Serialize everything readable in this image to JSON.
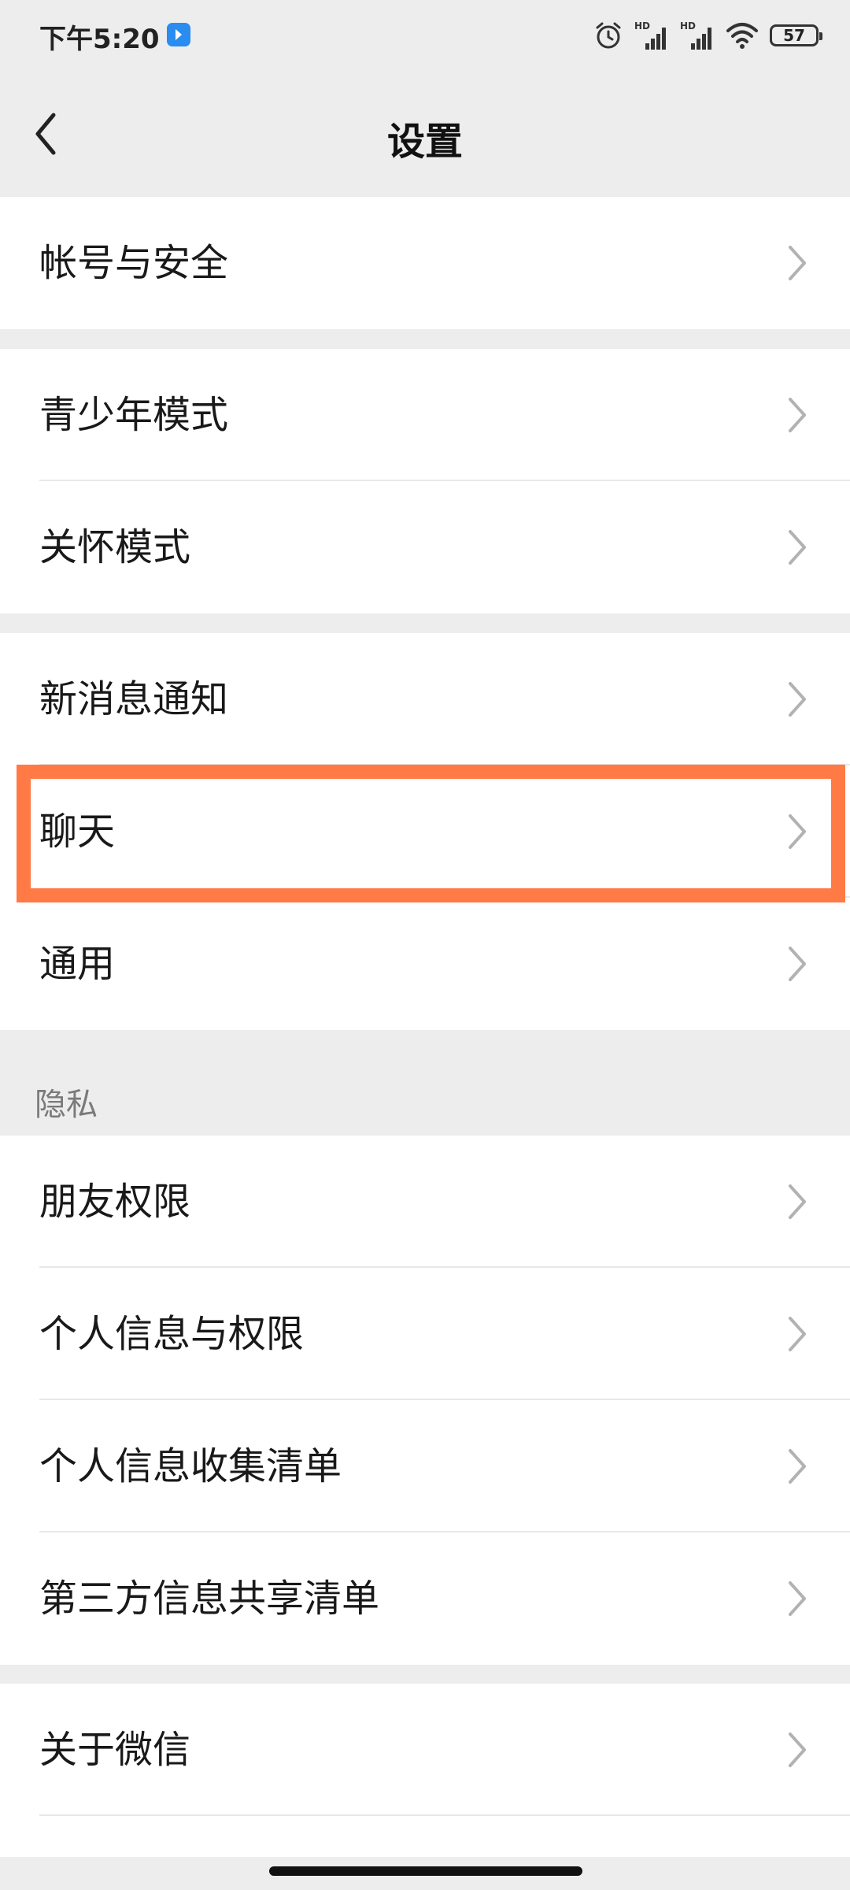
{
  "status_bar": {
    "time": "下午5:20",
    "battery": "57",
    "icons": [
      "app-notification-icon",
      "alarm-icon",
      "hd-signal-icon",
      "hd-signal-icon",
      "wifi-icon",
      "battery-icon"
    ]
  },
  "nav": {
    "title": "设置",
    "back_icon": "chevron-left-icon"
  },
  "groups": [
    {
      "items": [
        "帐号与安全"
      ]
    },
    {
      "items": [
        "青少年模式",
        "关怀模式"
      ]
    },
    {
      "items": [
        "新消息通知",
        "聊天",
        "通用"
      ]
    },
    {
      "section_title": "隐私",
      "items": [
        "朋友权限",
        "个人信息与权限",
        "个人信息收集清单",
        "第三方信息共享清单"
      ]
    },
    {
      "items": [
        "关于微信"
      ]
    }
  ],
  "highlighted_item": "聊天",
  "colors": {
    "background": "#ededed",
    "row": "#ffffff",
    "highlight": "#ff7a45",
    "text": "#191919",
    "secondary_text": "#7a7a7a"
  }
}
